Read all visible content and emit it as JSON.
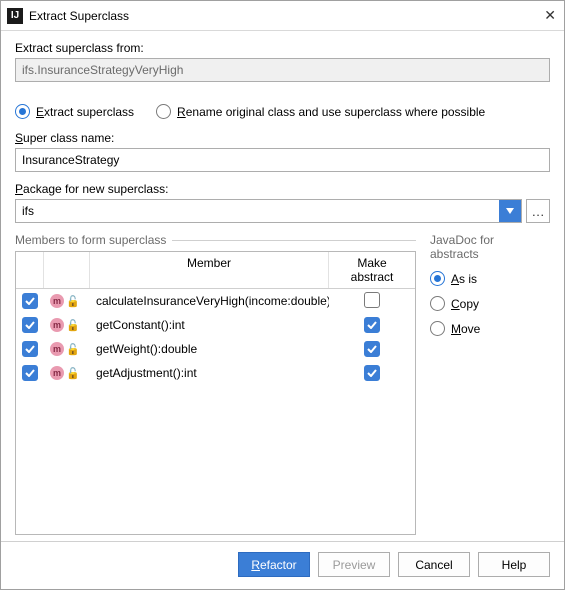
{
  "titlebar": {
    "title": "Extract Superclass"
  },
  "labels": {
    "from": "Extract superclass from:",
    "fromValue": "ifs.InsuranceStrategyVeryHigh",
    "radioExtract": "Extract superclass",
    "radioRename": "Rename original class and use superclass where possible",
    "superName": "Super class name:",
    "superNameValue": "InsuranceStrategy",
    "pkg": "Package for new superclass:",
    "pkgValue": "ifs",
    "membersGroup": "Members to form superclass",
    "javadocGroup": "JavaDoc for abstracts",
    "colMember": "Member",
    "colAbstract": "Make abstract"
  },
  "members": [
    {
      "checked": true,
      "name": "calculateInsuranceVeryHigh(income:double):double",
      "abstract": false
    },
    {
      "checked": true,
      "name": "getConstant():int",
      "abstract": true
    },
    {
      "checked": true,
      "name": "getWeight():double",
      "abstract": true
    },
    {
      "checked": true,
      "name": "getAdjustment():int",
      "abstract": true
    }
  ],
  "javadoc": {
    "asis": "As is",
    "copy": "Copy",
    "move": "Move",
    "selected": "asis"
  },
  "buttons": {
    "refactor": "Refactor",
    "preview": "Preview",
    "cancel": "Cancel",
    "help": "Help"
  }
}
